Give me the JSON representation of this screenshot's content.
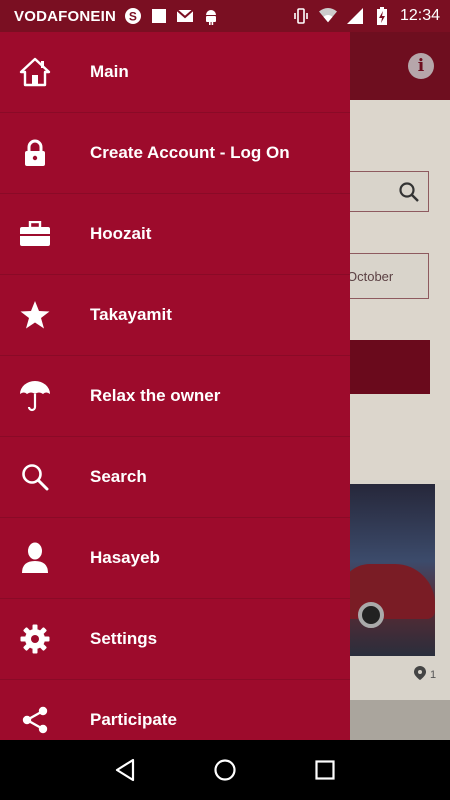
{
  "status_bar": {
    "carrier": "VODAFONEIN",
    "time": "12:34",
    "left_icons": [
      "skype-icon",
      "square-notification-icon",
      "gmail-icon",
      "android-icon"
    ],
    "right_icons": [
      "vibrate-icon",
      "wifi-icon",
      "signal-icon",
      "battery-charging-icon"
    ]
  },
  "app_background": {
    "date_field_text": "October",
    "card_meta": "1"
  },
  "drawer": {
    "items": [
      {
        "label": "Main",
        "icon": "home-icon"
      },
      {
        "label": "Create Account - Log On",
        "icon": "lock-icon"
      },
      {
        "label": "Hoozait",
        "icon": "briefcase-icon"
      },
      {
        "label": "Takayamit",
        "icon": "star-icon"
      },
      {
        "label": "Relax the owner",
        "icon": "umbrella-icon"
      },
      {
        "label": "Search",
        "icon": "search-icon"
      },
      {
        "label": "Hasayeb",
        "icon": "person-icon"
      },
      {
        "label": "Settings",
        "icon": "gear-icon"
      },
      {
        "label": "Participate",
        "icon": "share-icon"
      }
    ]
  },
  "colors": {
    "drawer_bg": "#9d0b2c",
    "status_bar_bg": "#7a0f22",
    "app_bar_bg": "#6e0e1f"
  }
}
